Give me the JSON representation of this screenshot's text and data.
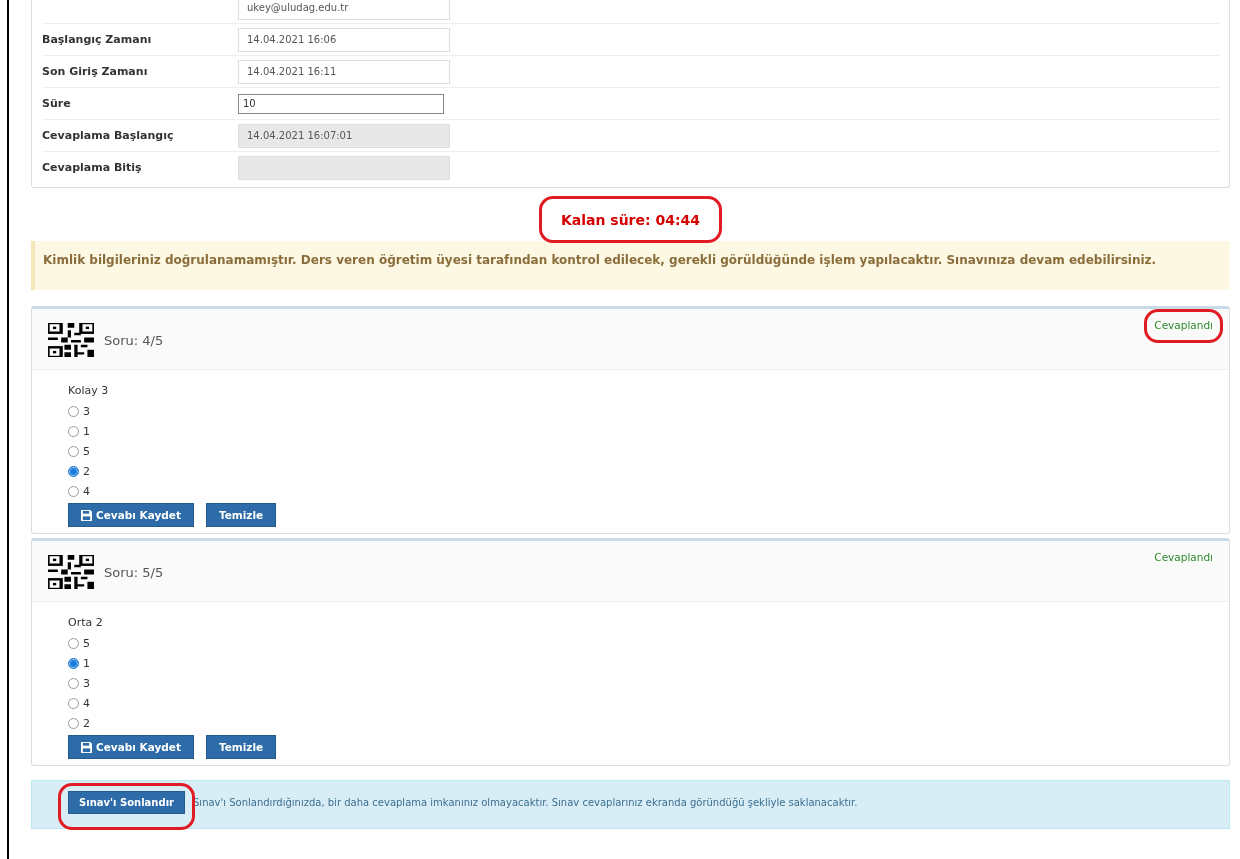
{
  "info_rows": [
    {
      "label": null,
      "value": "ukey@uludag.edu.tr",
      "kind": "plain"
    },
    {
      "label": "Başlangıç Zamanı",
      "value": "14.04.2021 16:06",
      "kind": "plain"
    },
    {
      "label": "Son Giriş Zamanı",
      "value": "14.04.2021 16:11",
      "kind": "plain"
    },
    {
      "label": "Süre",
      "value": "10",
      "kind": "input"
    },
    {
      "label": "Cevaplama Başlangıç",
      "value": "14.04.2021 16:07:01",
      "kind": "readonly"
    },
    {
      "label": "Cevaplama Bitiş",
      "value": "",
      "kind": "readonly"
    }
  ],
  "timer": {
    "text": "Kalan süre: 04:44",
    "circled": true
  },
  "alert": "Kimlik bilgileriniz doğrulanamamıştır. Ders veren öğretim üyesi tarafından kontrol edilecek, gerekli görüldüğünde işlem yapılacaktır. Sınavınıza devam edebilirsiniz.",
  "questions": [
    {
      "title": "Soru: 4/5",
      "status": "Cevaplandı",
      "circled": true,
      "prompt": "Kolay 3",
      "options": [
        {
          "label": "3",
          "selected": false
        },
        {
          "label": "1",
          "selected": false
        },
        {
          "label": "5",
          "selected": false
        },
        {
          "label": "2",
          "selected": true
        },
        {
          "label": "4",
          "selected": false
        }
      ],
      "save_button": "Cevabı Kaydet",
      "clear_button": "Temizle"
    },
    {
      "title": "Soru: 5/5",
      "status": "Cevaplandı",
      "circled": false,
      "prompt": "Orta 2",
      "options": [
        {
          "label": "5",
          "selected": false
        },
        {
          "label": "1",
          "selected": true
        },
        {
          "label": "3",
          "selected": false
        },
        {
          "label": "4",
          "selected": false
        },
        {
          "label": "2",
          "selected": false
        }
      ],
      "save_button": "Cevabı Kaydet",
      "clear_button": "Temizle"
    }
  ],
  "footer": {
    "button": "Sınav'ı Sonlandır",
    "button_circled": true,
    "note": "Sınav'ı Sonlandırdığınızda, bir daha cevaplama imkanınız olmayacaktır. Sınav cevaplarınız ekranda göründüğü şekliyle saklanacaktır."
  }
}
